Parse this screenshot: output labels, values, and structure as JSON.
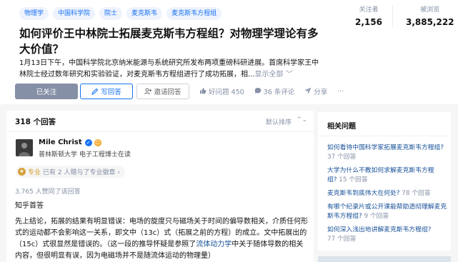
{
  "topics": [
    "物理学",
    "中国科学院",
    "院士",
    "麦克斯韦",
    "麦克斯韦方程组"
  ],
  "stats": {
    "followers_label": "关注者",
    "followers_value": "2,156",
    "views_label": "被浏览",
    "views_value": "3,885,222"
  },
  "question": {
    "title": "如何评价王中林院士拓展麦克斯韦方程组？对物理学理论有多大价值？",
    "description": "1月13日下午，中国科学院北京纳米能源与系统研究所发布两项重磅科研进展。首席科学家王中林院士经过数年研究和实验验证，对麦克斯韦方程组进行了成功拓展，相...",
    "show_all": "显示全部 ﹀"
  },
  "actions": {
    "follow": "已关注",
    "write": "写回答",
    "invite": "邀请回答",
    "like": "好问题 450",
    "comment": "36 条评论",
    "share": "分享",
    "more": "···"
  },
  "answers": {
    "count_label": "318 个回答",
    "sort_label": "默认排序",
    "sort_icon": "⌃⌄",
    "author_name": "Mile Christ",
    "author_desc": "普林斯顿大学 电子工程博士在读",
    "zhuanye_label": "专业",
    "zhuanye_text": "已有 2 人赠与了专业徽章 ›",
    "agree_text": "3,765 人赞同了该回答",
    "first_line": "知乎首答",
    "body_part1": "先上结论，拓展的结果有明显错误：电场的旋度只与磁场关于时间的偏导数相关，介质任何形式的运动都不会影响这一关系，即文中（13c）式（拓展之前的方程）的成立。文中拓展出的（15c）式很显然是错误的。（这一段的推导怀疑是参照了",
    "body_link": "流体动力学",
    "body_part2": "中关于随体导数的相关内容，但很明显有误，因为电磁场并不是随流体运动的物理量）"
  },
  "related": {
    "title": "相关问题",
    "items": [
      {
        "q": "如何看待中国科学家拓展麦克斯韦方程组?",
        "a": "37 个回答"
      },
      {
        "q": "大学为什么不教如何求解麦克斯韦方程组?",
        "a": "15 个回答"
      },
      {
        "q": "麦克斯韦到底伟大在何处?",
        "a": "78 个回答"
      },
      {
        "q": "有哪个纪录片或公开课能帮助透彻理解麦克斯韦方程组?",
        "a": "9 个回答"
      },
      {
        "q": "如何深入浅出地讲解麦克斯韦方程组?",
        "a": "77 个回答"
      }
    ]
  }
}
